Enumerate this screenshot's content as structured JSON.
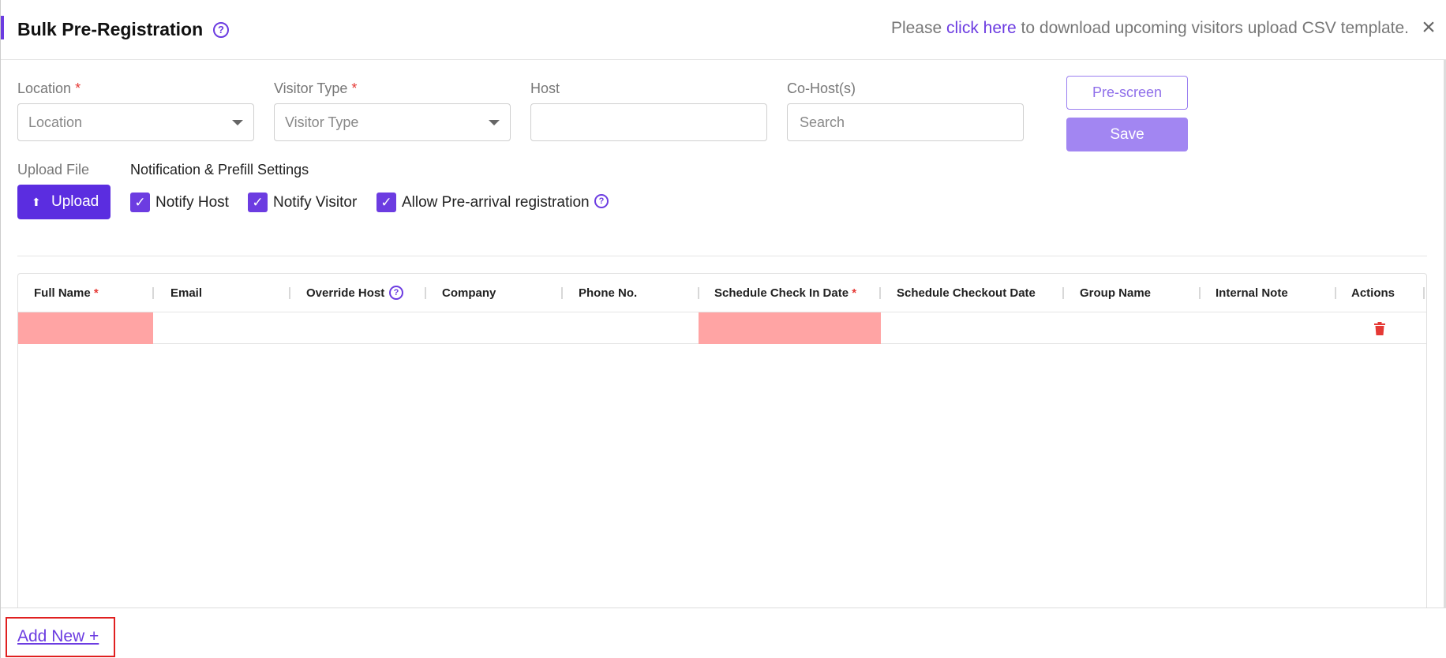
{
  "header": {
    "title": "Bulk Pre-Registration",
    "note_before": "Please",
    "note_link": "click here",
    "note_after": "to download upcoming visitors upload CSV template."
  },
  "form": {
    "location": {
      "label": "Location",
      "placeholder": "Location",
      "required_mark": "*"
    },
    "visitor_type": {
      "label": "Visitor Type",
      "placeholder": "Visitor Type",
      "required_mark": "*"
    },
    "host": {
      "label": "Host",
      "value": ""
    },
    "co_host": {
      "label": "Co-Host(s)",
      "placeholder": "Search"
    },
    "prescreen_label": "Pre-screen",
    "save_label": "Save",
    "upload_file_label": "Upload File",
    "upload_button_label": "Upload",
    "notification_heading": "Notification & Prefill Settings",
    "checkboxes": [
      {
        "label": "Notify Host",
        "checked": true
      },
      {
        "label": "Notify Visitor",
        "checked": true
      },
      {
        "label": "Allow Pre-arrival registration",
        "checked": true
      }
    ]
  },
  "table": {
    "columns": [
      {
        "label": "Full Name",
        "required": "*"
      },
      {
        "label": "Email"
      },
      {
        "label": "Override Host"
      },
      {
        "label": "Company"
      },
      {
        "label": "Phone No."
      },
      {
        "label": "Schedule Check In Date",
        "required": "*"
      },
      {
        "label": "Schedule Checkout Date"
      },
      {
        "label": "Group Name"
      },
      {
        "label": "Internal Note"
      },
      {
        "label": "Actions"
      }
    ],
    "rows": [
      {
        "full_name": "",
        "email": "",
        "override_host": "",
        "company": "",
        "phone": "",
        "check_in": "",
        "checkout": "",
        "group": "",
        "note": ""
      }
    ]
  },
  "footer": {
    "add_new_label": "Add New +"
  },
  "colors": {
    "accent": "#6c3ce1",
    "error_cell": "#ffa4a4",
    "danger": "#e53935"
  }
}
